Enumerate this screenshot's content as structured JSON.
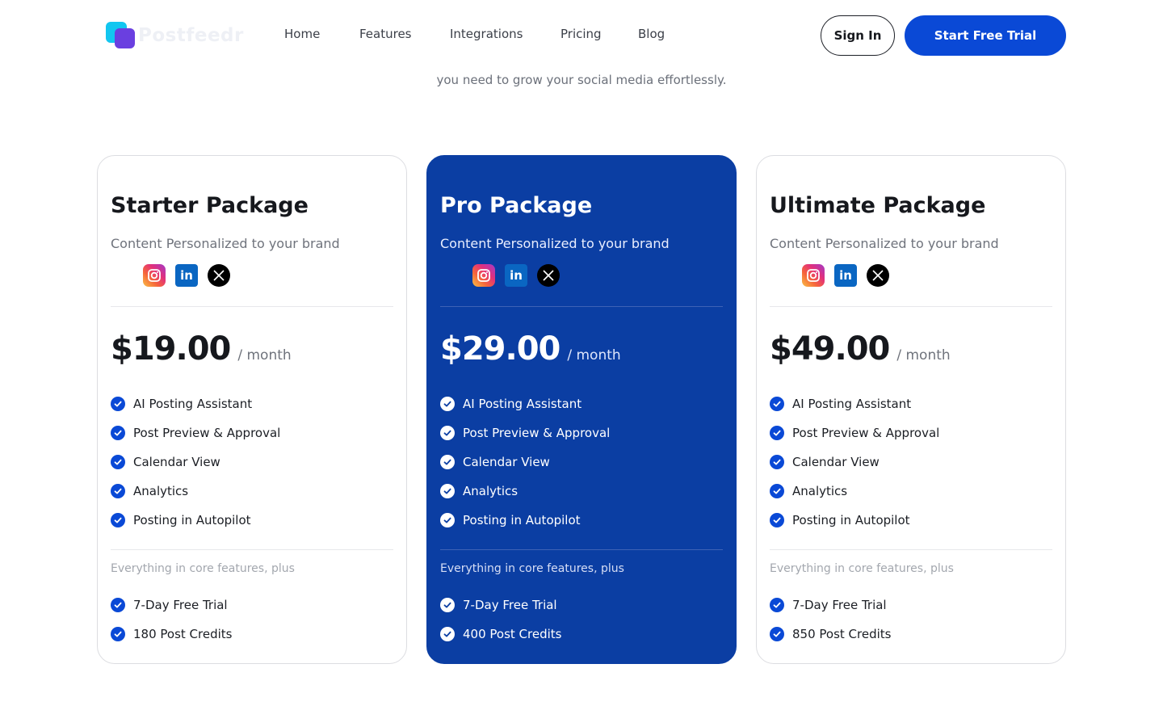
{
  "brand": {
    "name": "Postfeedr"
  },
  "nav": {
    "items": [
      "Home",
      "Features",
      "Integrations",
      "Pricing",
      "Blog"
    ]
  },
  "header": {
    "sign_in_label": "Sign In",
    "trial_label": "Start Free Trial"
  },
  "hero": {
    "subtitle": "you need to grow your social media effortlessly."
  },
  "colors": {
    "accent": "#0a49d6",
    "pro_card_bg": "#0b3ea3"
  },
  "plans": [
    {
      "title": "Starter Package",
      "subtitle": "Content Personalized to your brand",
      "socials": [
        "instagram-icon",
        "linkedin-icon",
        "x-icon"
      ],
      "price": "$19.00",
      "period": "/ month",
      "features": [
        "AI Posting Assistant",
        "Post Preview & Approval",
        "Calendar View",
        "Analytics",
        "Posting in Autopilot"
      ],
      "plus_label": "Everything in core features, plus",
      "extras": [
        "7-Day Free Trial",
        "180 Post Credits"
      ]
    },
    {
      "title": "Pro Package",
      "subtitle": "Content Personalized to your brand",
      "socials": [
        "instagram-icon",
        "linkedin-icon",
        "x-icon"
      ],
      "price": "$29.00",
      "period": "/ month",
      "features": [
        "AI Posting Assistant",
        "Post Preview & Approval",
        "Calendar View",
        "Analytics",
        "Posting in Autopilot"
      ],
      "plus_label": "Everything in core features, plus",
      "extras": [
        "7-Day Free Trial",
        "400 Post Credits"
      ]
    },
    {
      "title": "Ultimate Package",
      "subtitle": "Content Personalized to your brand",
      "socials": [
        "instagram-icon",
        "linkedin-icon",
        "x-icon"
      ],
      "price": "$49.00",
      "period": "/ month",
      "features": [
        "AI Posting Assistant",
        "Post Preview & Approval",
        "Calendar View",
        "Analytics",
        "Posting in Autopilot"
      ],
      "plus_label": "Everything in core features, plus",
      "extras": [
        "7-Day Free Trial",
        "850 Post Credits"
      ]
    }
  ]
}
